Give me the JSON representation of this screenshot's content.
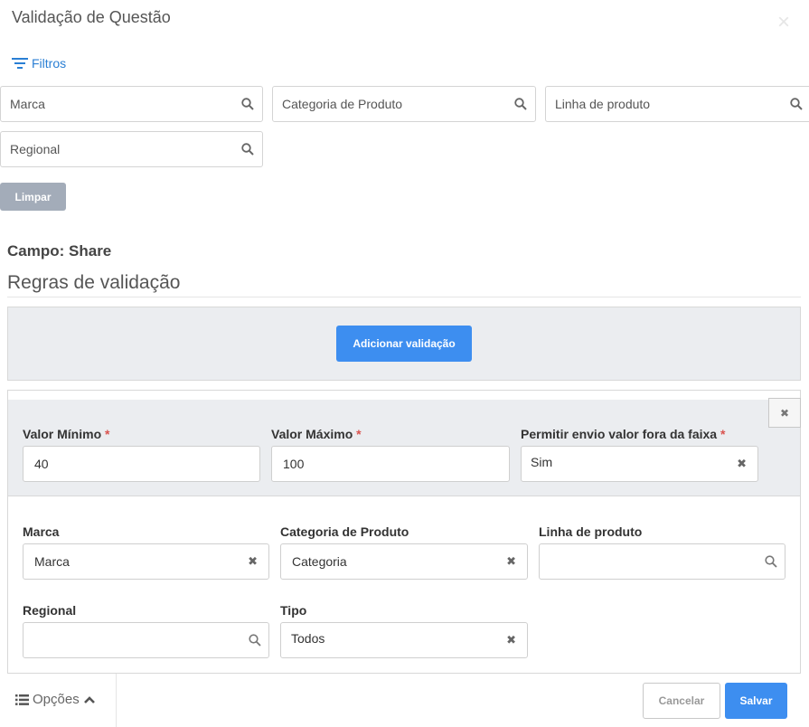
{
  "dialog": {
    "title": "Validação de Questão",
    "close_glyph": "×"
  },
  "filters": {
    "toggle_label": "Filtros",
    "fields": [
      {
        "placeholder": "Marca"
      },
      {
        "placeholder": "Categoria de Produto"
      },
      {
        "placeholder": "Linha de produto"
      },
      {
        "placeholder": "Regional"
      }
    ],
    "clear_label": "Limpar"
  },
  "campo": {
    "prefix": "Campo:",
    "value": "Share"
  },
  "rules": {
    "heading": "Regras de validação",
    "add_label": "Adicionar validação",
    "rule": {
      "min_label": "Valor Mínimo",
      "min_value": "40",
      "max_label": "Valor Máximo",
      "max_value": "100",
      "allow_label": "Permitir envio valor fora da faixa",
      "allow_value": "Sim",
      "required_mark": "*",
      "marca_label": "Marca",
      "marca_value": "Marca",
      "categoria_label": "Categoria de Produto",
      "categoria_value": "Categoria",
      "linha_label": "Linha de produto",
      "linha_value": "",
      "regional_label": "Regional",
      "regional_value": "",
      "tipo_label": "Tipo",
      "tipo_value": "Todos"
    }
  },
  "footer": {
    "options_label": "Opções",
    "cancel_label": "Cancelar",
    "save_label": "Salvar"
  },
  "colors": {
    "primary": "#3d8ef0",
    "link": "#2a7fd4",
    "required": "#d9534f",
    "muted_button": "#a3acb9"
  }
}
